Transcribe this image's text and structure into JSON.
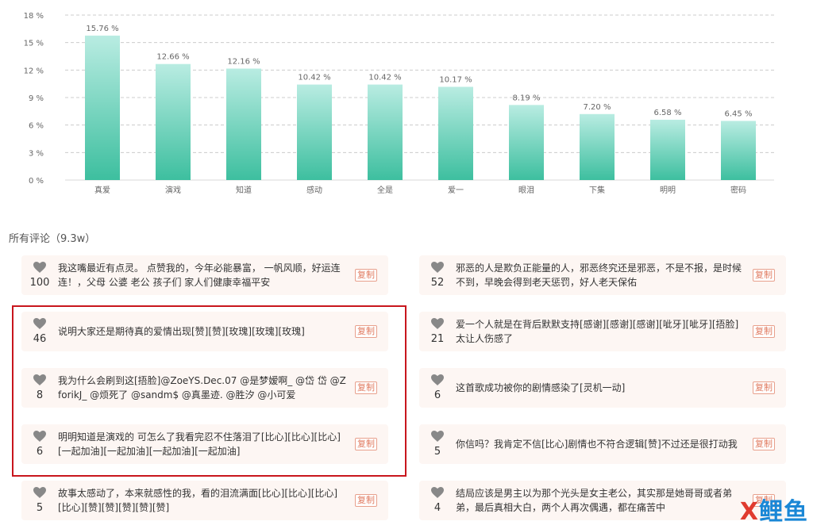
{
  "chart_data": {
    "type": "bar",
    "categories": [
      "真爱",
      "演戏",
      "知道",
      "感动",
      "全是",
      "爱一",
      "眼泪",
      "下集",
      "明明",
      "密码"
    ],
    "values": [
      15.76,
      12.66,
      12.16,
      10.42,
      10.42,
      10.17,
      8.19,
      7.2,
      6.58,
      6.45
    ],
    "value_labels": [
      "15.76 %",
      "12.66 %",
      "12.16 %",
      "10.42 %",
      "10.42 %",
      "10.17 %",
      "8.19 %",
      "7.20 %",
      "6.58 %",
      "6.45 %"
    ],
    "yticks": [
      0,
      3,
      6,
      9,
      12,
      15,
      18
    ],
    "ytick_labels": [
      "0 %",
      "3 %",
      "6 %",
      "9 %",
      "12 %",
      "15 %",
      "18 %"
    ],
    "ylim": [
      0,
      18
    ],
    "grid": true,
    "colors": {
      "bar_top": "#b9ece2",
      "bar_bottom": "#3dbf9f",
      "grid": "#cccccc"
    }
  },
  "comments": {
    "title": "所有评论（9.3w）",
    "copy_label": "复制",
    "left": [
      {
        "likes": "100",
        "text": "我这嘴最近有点灵。 点赞我的，今年必能暴富， 一帆风顺，好运连连！，父母 公婆 老公 孩子们 家人们健康幸福平安"
      },
      {
        "likes": "46",
        "text": "说明大家还是期待真的爱情出现[赞][赞][玫瑰][玫瑰][玫瑰]"
      },
      {
        "likes": "8",
        "text": "我为什么会刷到这[捂脸]@ZoeYS.Dec.07 @是梦嫒啊_ @岱 岱 @ZforikJ_ @烦死了 @sandm$ @真墨迹. @胜汐 @小可爱"
      },
      {
        "likes": "6",
        "text": "明明知道是演戏的 可怎么了我看完忍不住落泪了[比心][比心][比心][一起加油][一起加油][一起加油][一起加油]"
      },
      {
        "likes": "5",
        "text": "故事太感动了，本来就感性的我，看的泪流满面[比心][比心][比心][比心][赞][赞][赞][赞][赞]"
      }
    ],
    "right": [
      {
        "likes": "52",
        "text": "邪恶的人是欺负正能量的人，邪恶终究还是邪恶，不是不报，是时候不到，早晚会得到老天惩罚，好人老天保佑"
      },
      {
        "likes": "21",
        "text": "爱一个人就是在背后默默支持[感谢][感谢][感谢][呲牙][呲牙][捂脸]太让人伤感了"
      },
      {
        "likes": "6",
        "text": "这首歌成功被你的剧情感染了[灵机一动]"
      },
      {
        "likes": "5",
        "text": "你信吗？我肯定不信[比心]剧情也不符合逻辑[赞]不过还是很打动我"
      },
      {
        "likes": "4",
        "text": "结局应该是男主以为那个光头是女主老公，其实那是她哥哥或者弟弟，最后真相大白，两个人再次偶遇，都在痛苦中"
      }
    ]
  },
  "watermark": {
    "x": "X",
    "brand": "鲤鱼"
  }
}
